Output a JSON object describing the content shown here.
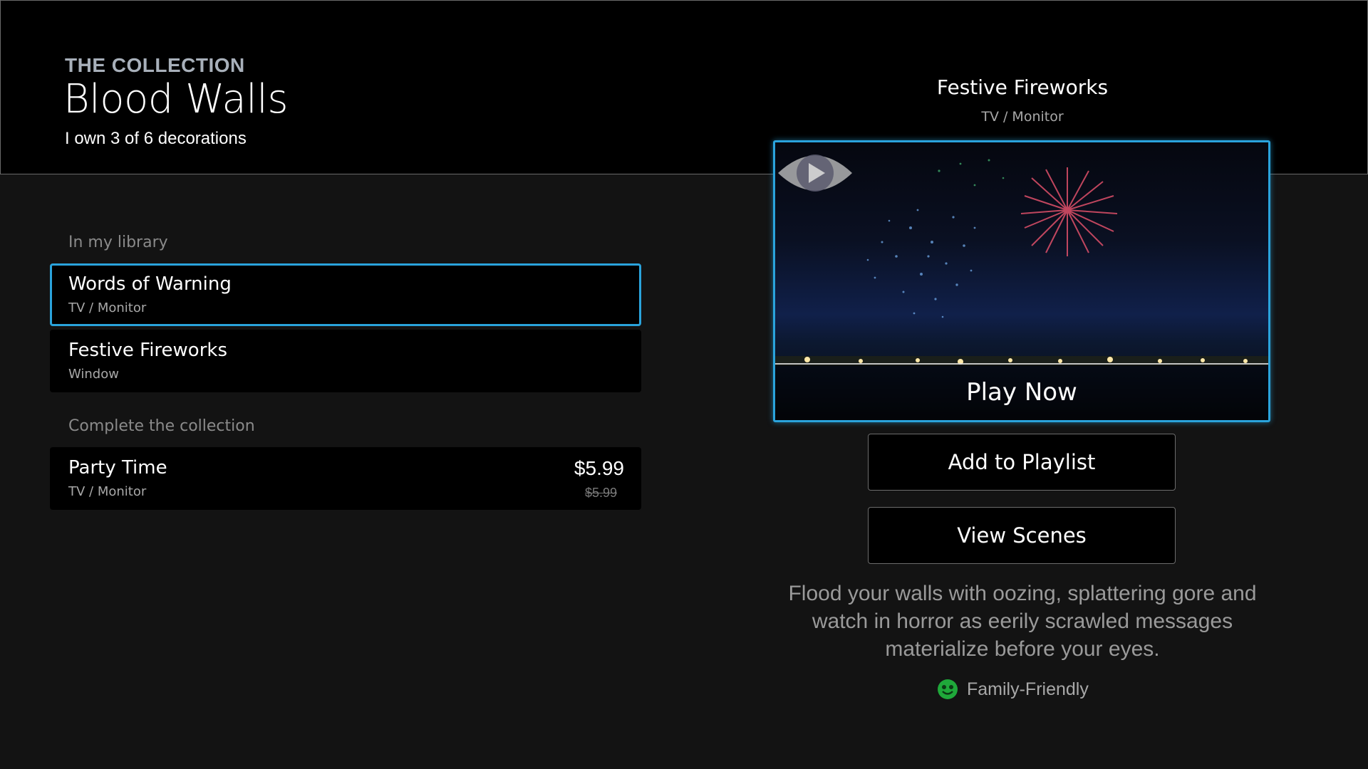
{
  "header": {
    "eyebrow": "THE COLLECTION",
    "title": "Blood Walls",
    "ownership": "I own 3 of 6 decorations"
  },
  "library": {
    "label": "In my library",
    "items": [
      {
        "title": "Words of Warning",
        "subtitle": "TV / Monitor",
        "focused": true
      },
      {
        "title": "Festive Fireworks",
        "subtitle": "Window",
        "focused": false
      }
    ]
  },
  "complete": {
    "label": "Complete the collection",
    "items": [
      {
        "title": "Party Time",
        "subtitle": "TV / Monitor",
        "price": "$5.99",
        "original_price": "$5.99"
      }
    ]
  },
  "detail": {
    "title": "Festive Fireworks",
    "subtitle": "TV / Monitor",
    "play_label": "Play Now",
    "add_playlist_label": "Add to Playlist",
    "view_scenes_label": "View Scenes",
    "description": "Flood your walls with oozing, splattering gore and watch in horror as eerily scrawled messages materialize before your eyes.",
    "rating_label": "Family-Friendly",
    "rating_icon": "smiley-face-icon"
  },
  "colors": {
    "accent": "#2aa3dc",
    "rating": "#1fa83a",
    "background": "#131313",
    "panel": "#000000"
  }
}
